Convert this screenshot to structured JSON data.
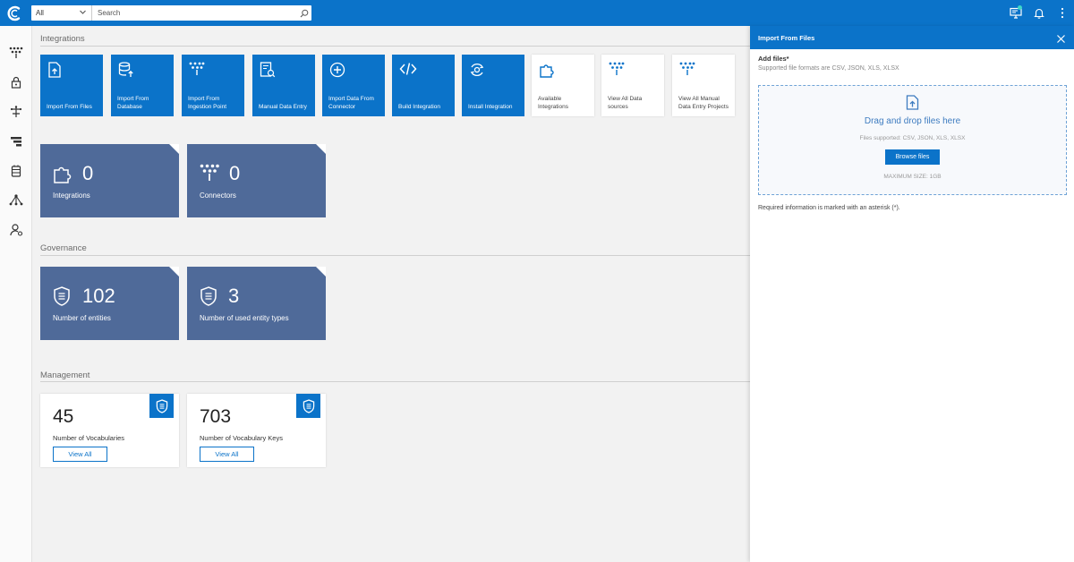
{
  "topbar": {
    "logo_icon": "c-logo-icon",
    "scope_value": "All",
    "search_placeholder": "Search",
    "icons": [
      "monitor-icon",
      "bell-icon",
      "more-vertical-icon"
    ]
  },
  "leftnav": {
    "items": [
      "fan-icon",
      "lock-icon",
      "route-icon",
      "sliders-icon",
      "database-icon",
      "network-icon",
      "user-settings-icon"
    ]
  },
  "sections": {
    "integrations": "Integrations",
    "governance": "Governance",
    "management": "Management"
  },
  "tiles": [
    {
      "label": "Import From Files",
      "icon": "file-upload-icon"
    },
    {
      "label": "Import From Database",
      "icon": "database-upload-icon"
    },
    {
      "label": "Import From Ingestion Point",
      "icon": "ingestion-point-icon"
    },
    {
      "label": "Manual Data Entry",
      "icon": "manual-entry-icon"
    },
    {
      "label": "Import Data From Connector",
      "icon": "plus-circle-icon"
    },
    {
      "label": "Build Integration",
      "icon": "code-icon"
    },
    {
      "label": "Install Integration",
      "icon": "install-icon"
    },
    {
      "label": "Available Integrations",
      "icon": "puzzle-icon"
    },
    {
      "label": "View All Data sources",
      "icon": "data-sources-icon"
    },
    {
      "label": "View All Manual Data Entry Projects",
      "icon": "manual-projects-icon"
    }
  ],
  "stats": {
    "integrations": {
      "value": "0",
      "label": "Integrations",
      "icon": "puzzle-icon"
    },
    "connectors": {
      "value": "0",
      "label": "Connectors",
      "icon": "connector-icon"
    },
    "entities": {
      "value": "102",
      "label": "Number of entities",
      "icon": "shield-icon"
    },
    "entity_types": {
      "value": "3",
      "label": "Number of used entity types",
      "icon": "shield-icon"
    }
  },
  "management": {
    "vocabularies": {
      "value": "45",
      "label": "Number of Vocabularies",
      "button": "View All"
    },
    "vocabulary_keys": {
      "value": "703",
      "label": "Number of Vocabulary Keys",
      "button": "View All"
    }
  },
  "panel": {
    "title": "Import From Files",
    "add_files_label": "Add files*",
    "formats_text": "Supported file formats are CSV, JSON, XLS, XLSX",
    "drop_title": "Drag and drop files here",
    "supported_text": "Files supported: CSV, JSON, XLS, XLSX",
    "browse_label": "Browse files",
    "max_size_text": "MAXIMUM SIZE: 1GB",
    "required_text": "Required information is marked with an asterisk (*)."
  },
  "colors": {
    "brand_blue": "#0b73c9",
    "stat_slate": "#4f6a99",
    "background": "#f2f2f2"
  }
}
